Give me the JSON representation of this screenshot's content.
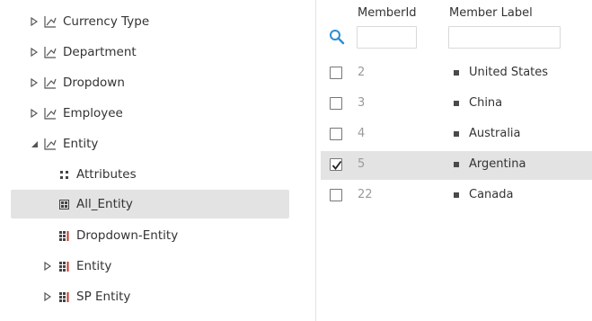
{
  "tree": {
    "items": [
      {
        "label": "Currency Type",
        "caret": "right",
        "icon": "hierarchy-icon"
      },
      {
        "label": "Department",
        "caret": "right",
        "icon": "hierarchy-icon"
      },
      {
        "label": "Dropdown",
        "caret": "right",
        "icon": "hierarchy-icon"
      },
      {
        "label": "Employee",
        "caret": "right",
        "icon": "hierarchy-icon"
      },
      {
        "label": "Entity",
        "caret": "down",
        "icon": "hierarchy-icon"
      },
      {
        "label": "Attributes",
        "caret": "none",
        "icon": "attributes-icon"
      },
      {
        "label": "All_Entity",
        "caret": "none",
        "icon": "grid-icon",
        "selected": true
      },
      {
        "label": "Dropdown-Entity",
        "caret": "none",
        "icon": "grid-red-icon"
      },
      {
        "label": "Entity",
        "caret": "right",
        "icon": "grid-red-icon"
      },
      {
        "label": "SP Entity",
        "caret": "right",
        "icon": "grid-red-icon"
      }
    ]
  },
  "members": {
    "header": {
      "member_id": "MemberId",
      "member_label": "Member Label"
    },
    "filter": {
      "member_id_value": "",
      "member_label_value": ""
    },
    "rows": [
      {
        "id": "2",
        "label": "United States",
        "checked": false
      },
      {
        "id": "3",
        "label": "China",
        "checked": false
      },
      {
        "id": "4",
        "label": "Australia",
        "checked": false
      },
      {
        "id": "5",
        "label": "Argentina",
        "checked": true
      },
      {
        "id": "22",
        "label": "Canada",
        "checked": false
      }
    ]
  },
  "colors": {
    "selected_bg": "#e3e3e3",
    "search_icon": "#2a8fd4",
    "grid_red_accent": "#c0392b"
  }
}
